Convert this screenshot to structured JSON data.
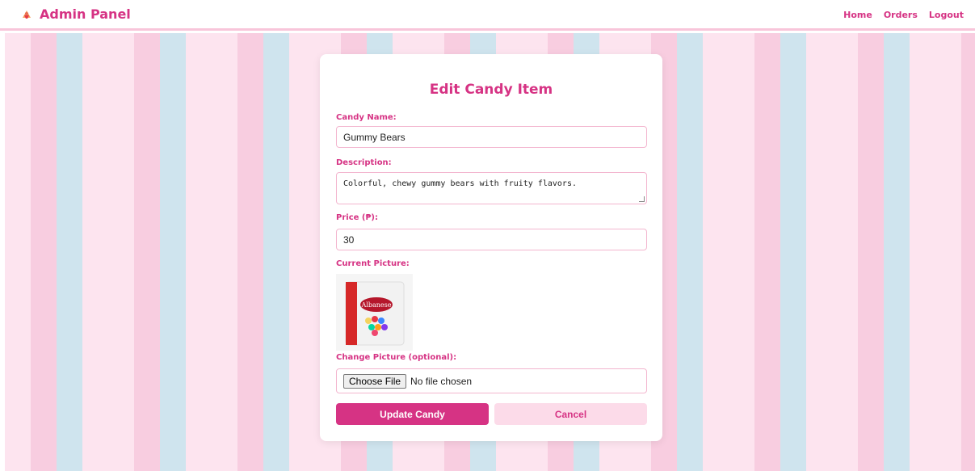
{
  "nav": {
    "brand": "Admin Panel",
    "links": [
      "Home",
      "Orders",
      "Logout"
    ]
  },
  "form": {
    "title": "Edit Candy Item",
    "name_label": "Candy Name:",
    "name_value": "Gummy Bears",
    "description_label": "Description:",
    "description_value": "Colorful, chewy gummy bears with fruity flavors.",
    "price_label": "Price (₱):",
    "price_value": "30",
    "current_picture_label": "Current Picture:",
    "change_picture_label": "Change Picture (optional):",
    "choose_file_label": "Choose File",
    "no_file_text": "No file chosen",
    "update_button": "Update Candy",
    "cancel_button": "Cancel",
    "package_brand": "Albanese"
  },
  "colors": {
    "accent": "#d63384",
    "stripe_pink_light": "#fde4ef",
    "stripe_pink": "#f8cde0",
    "stripe_blue": "#cfe4ee"
  }
}
